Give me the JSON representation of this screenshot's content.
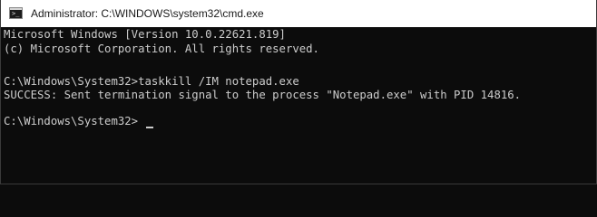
{
  "window": {
    "title": "Administrator: C:\\WINDOWS\\system32\\cmd.exe",
    "icon": "cmd-icon",
    "icon_glyph": ">_"
  },
  "console": {
    "lines": [
      "Microsoft Windows [Version 10.0.22621.819]",
      "(c) Microsoft Corporation. All rights reserved.",
      "C:\\Windows\\System32>taskkill /IM notepad.exe",
      "SUCCESS: Sent termination signal to the process \"Notepad.exe\" with PID 14816.",
      "C:\\Windows\\System32>"
    ],
    "background_color": "#0c0c0c",
    "text_color": "#cccccc"
  }
}
